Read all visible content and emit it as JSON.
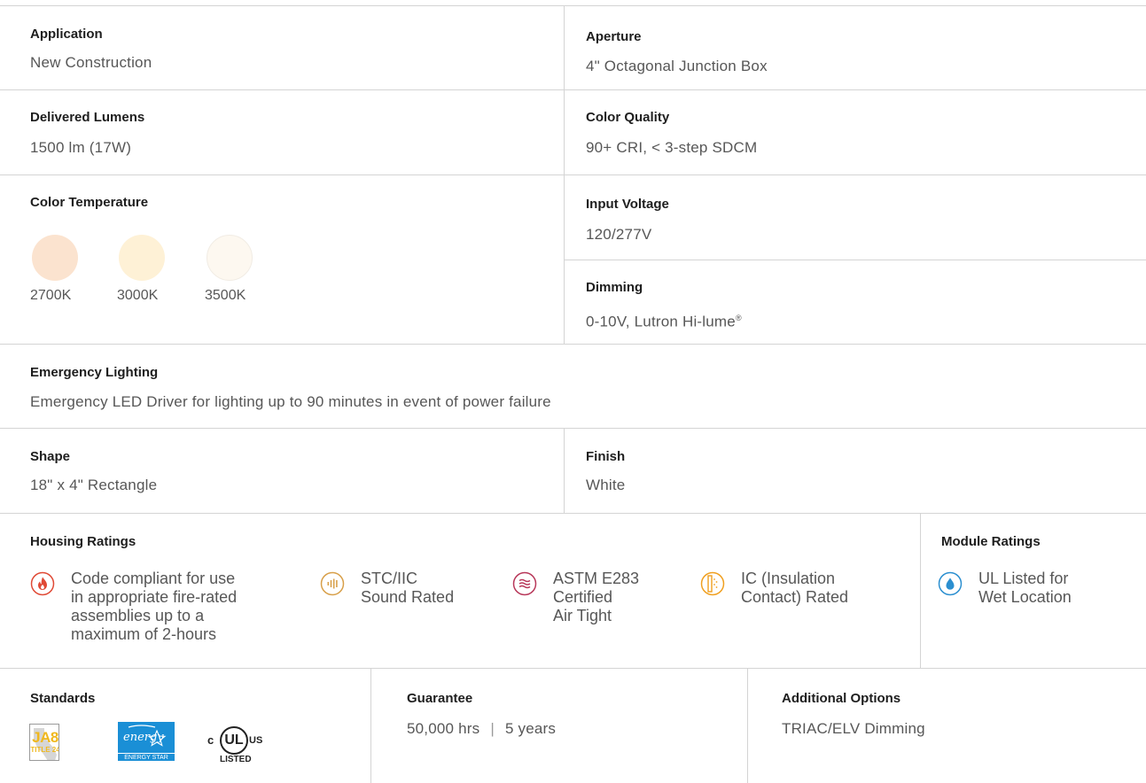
{
  "specs": {
    "application": {
      "label": "Application",
      "value": "New Construction"
    },
    "aperture": {
      "label": "Aperture",
      "value": "4\" Octagonal Junction Box"
    },
    "delivered_lumens": {
      "label": "Delivered Lumens",
      "value": "1500 lm (17W)"
    },
    "color_quality": {
      "label": "Color Quality",
      "value": "90+ CRI, < 3-step SDCM"
    },
    "color_temperature": {
      "label": "Color Temperature",
      "options": [
        {
          "label": "2700K",
          "color": "#fbe3cf"
        },
        {
          "label": "3000K",
          "color": "#fef1d6"
        },
        {
          "label": "3500K",
          "color": "#fdf8f0"
        }
      ]
    },
    "input_voltage": {
      "label": "Input Voltage",
      "value": "120/277V"
    },
    "dimming": {
      "label": "Dimming",
      "value": "0-10V, Lutron Hi-lume",
      "mark": "®"
    },
    "emergency": {
      "label": "Emergency Lighting",
      "value": "Emergency LED Driver for lighting up to 90 minutes in event of power failure"
    },
    "shape": {
      "label": "Shape",
      "value": "18\" x 4\" Rectangle"
    },
    "finish": {
      "label": "Finish",
      "value": "White"
    },
    "housing_ratings": {
      "label": "Housing Ratings",
      "items": [
        {
          "icon": "flame-icon",
          "color": "#e04a36",
          "text": "Code compliant for use\nin appropriate fire-rated\nassemblies up to a\nmaximum of 2-hours"
        },
        {
          "icon": "sound-icon",
          "color": "#d8a04a",
          "text": "STC/IIC\nSound Rated"
        },
        {
          "icon": "air-icon",
          "color": "#b8385a",
          "text": "ASTM E283\nCertified\nAir Tight"
        },
        {
          "icon": "insulation-icon",
          "color": "#f0a020",
          "text": "IC (Insulation\nContact) Rated"
        }
      ]
    },
    "module_ratings": {
      "label": "Module Ratings",
      "items": [
        {
          "icon": "water-drop-icon",
          "color": "#2b8fd0",
          "text": "UL Listed for\nWet Location"
        }
      ]
    },
    "standards": {
      "label": "Standards",
      "logos": {
        "ja8": {
          "top": "JA8",
          "bottom": "TITLE 24",
          "color": "#f0b81e"
        },
        "energy_star": {
          "script": "energy",
          "caption": "ENERGY STAR",
          "color": "#1a8fd6"
        },
        "ul": {
          "left": "c",
          "center": "UL",
          "right": "us",
          "caption": "LISTED"
        }
      }
    },
    "guarantee": {
      "label": "Guarantee",
      "hours": "50,000 hrs",
      "separator": "|",
      "years": "5 years"
    },
    "additional_options": {
      "label": "Additional Options",
      "value": "TRIAC/ELV Dimming"
    }
  }
}
